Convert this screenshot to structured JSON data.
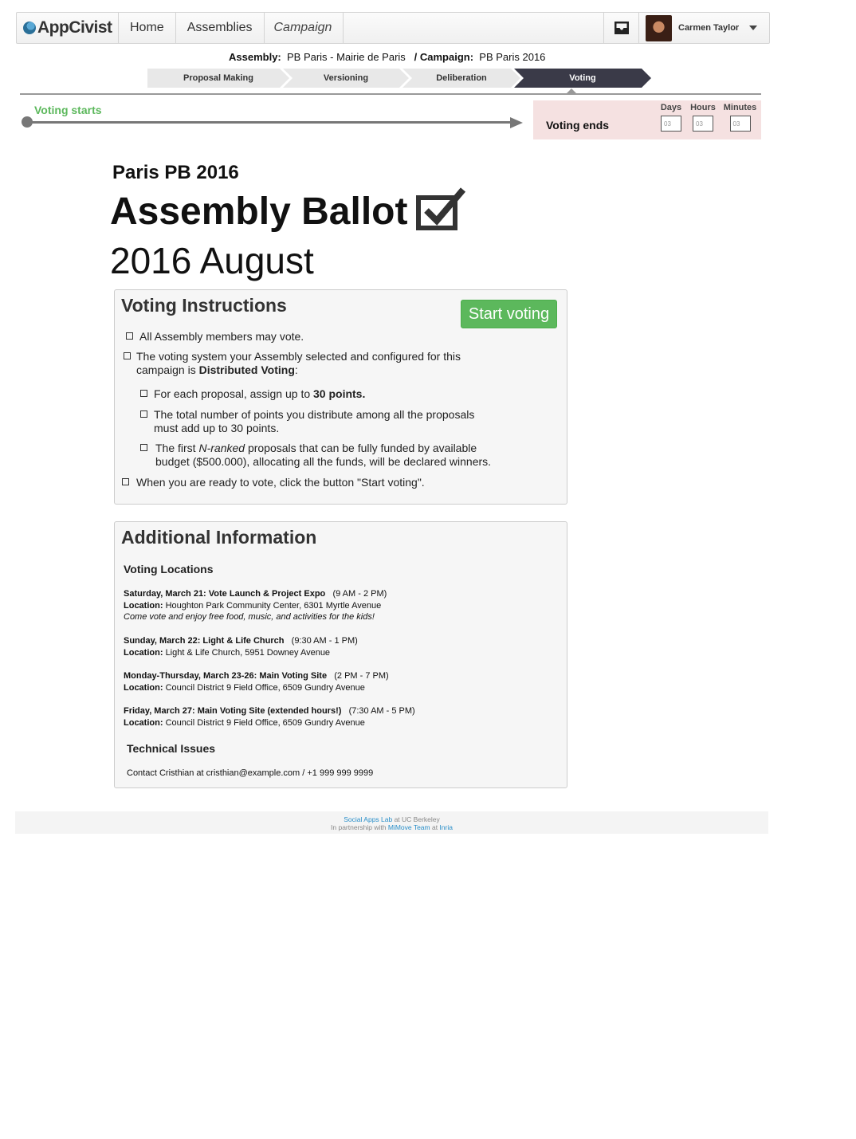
{
  "nav": {
    "logo": "AppCivist",
    "items": [
      {
        "label": "Home"
      },
      {
        "label": "Assemblies"
      }
    ],
    "campaign_label": "Campaign",
    "user_name": "Carmen Taylor"
  },
  "crumb": {
    "assembly_label": "Assembly:",
    "assembly_value": "PB Paris - Mairie de Paris",
    "campaign_label": "/ Campaign:",
    "campaign_value": "PB Paris 2016"
  },
  "stages": [
    {
      "label": "Proposal Making",
      "active": false
    },
    {
      "label": "Versioning",
      "active": false
    },
    {
      "label": "Deliberation",
      "active": false
    },
    {
      "label": "Voting",
      "active": true
    }
  ],
  "timeline": {
    "start_label": "Voting starts",
    "end_label": "Voting ends",
    "countdown": [
      {
        "label": "Days",
        "value": "03"
      },
      {
        "label": "Hours",
        "value": "03"
      },
      {
        "label": "Minutes",
        "value": "03"
      }
    ]
  },
  "heading": {
    "subtitle": "Paris PB 2016",
    "title": "Assembly Ballot",
    "date": "2016 August"
  },
  "instructions": {
    "title": "Voting Instructions",
    "start_button": "Start voting",
    "item1": "All Assembly members may vote.",
    "item2_line1": "The voting system your Assembly selected and configured for this",
    "item2_line2_prefix": "campaign is ",
    "item2_bold": "Distributed Voting",
    "item2_suffix": ":",
    "sub1_prefix": "For each proposal, assign up to ",
    "sub1_bold": "30 points.",
    "sub2_line1": "The total number of points you distribute among all the proposals",
    "sub2_line2": "must add up to 30 points.",
    "sub3_prefix": "The first ",
    "sub3_italic": "N-ranked",
    "sub3_rest": " proposals that can be fully funded by available",
    "sub3_line2": "budget ($500.000), allocating all the funds, will be declared winners.",
    "item3": "When you are ready to vote, click the button \"Start voting\"."
  },
  "additional": {
    "title": "Additional Information",
    "locations_title": "Voting Locations",
    "location_label": "Location:",
    "locations": [
      {
        "event": "Saturday, March 21: Vote Launch & Project Expo",
        "time": "(9 AM - 2 PM)",
        "place": "Houghton Park Community Center, 6301 Myrtle Avenue",
        "note": "Come vote and enjoy free food, music, and activities for the kids!"
      },
      {
        "event": "Sunday, March 22: Light & Life Church",
        "time": "(9:30 AM - 1 PM)",
        "place": "Light & Life Church, 5951 Downey Avenue"
      },
      {
        "event": "Monday-Thursday, March 23-26: Main Voting Site",
        "time": "(2 PM - 7 PM)",
        "place": "Council District 9 Field Office, 6509 Gundry Avenue"
      },
      {
        "event": "Friday, March 27: Main Voting Site (extended hours!)",
        "time": "(7:30 AM - 5 PM)",
        "place": "Council District 9 Field Office, 6509 Gundry Avenue"
      }
    ],
    "tech_title": "Technical Issues",
    "tech_contact": "Contact Cristhian at cristhian@example.com / +1 999 999 9999"
  },
  "footer": {
    "line1_link": "Social Apps Lab",
    "line1_rest": " at UC Berkeley",
    "line2_prefix": "In partnership with ",
    "line2_link1": "MiMove Team",
    "line2_mid": " at ",
    "line2_link2": "Inria"
  }
}
